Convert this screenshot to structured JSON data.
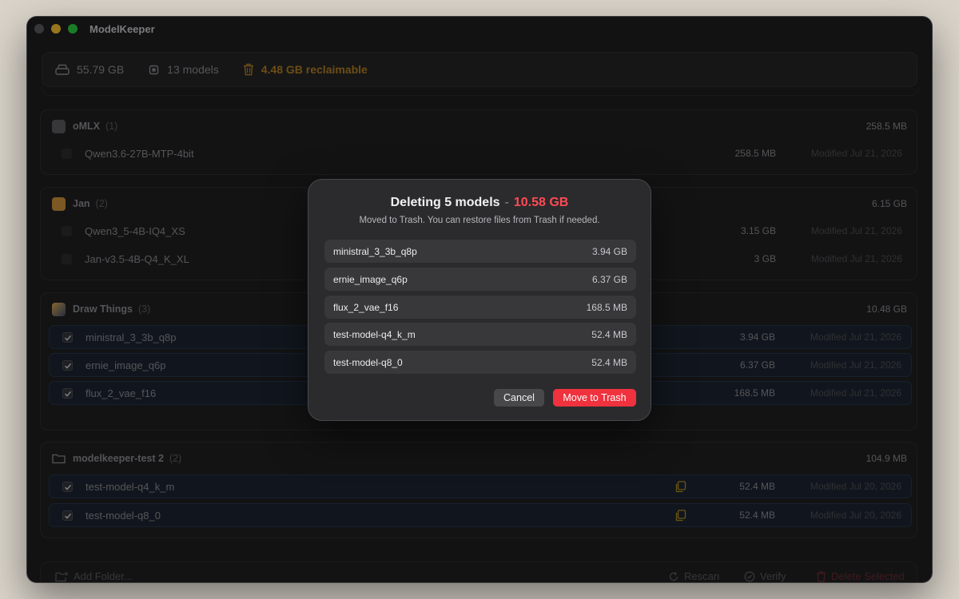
{
  "window": {
    "title": "ModelKeeper"
  },
  "stats": {
    "total_size": "55.79 GB",
    "model_count": "13 models",
    "reclaimable": "4.48 GB reclaimable"
  },
  "groups": [
    {
      "name": "oMLX",
      "count": "(1)",
      "size": "258.5 MB",
      "rows": [
        {
          "name": "Qwen3.6-27B-MTP-4bit",
          "size": "258.5 MB",
          "modified": "Modified Jul 21, 2026",
          "selected": false
        }
      ]
    },
    {
      "name": "Jan",
      "count": "(2)",
      "size": "6.15 GB",
      "rows": [
        {
          "name": "Qwen3_5-4B-IQ4_XS",
          "size": "3.15 GB",
          "modified": "Modified Jul 21, 2026",
          "selected": false
        },
        {
          "name": "Jan-v3.5-4B-Q4_K_XL",
          "size": "3 GB",
          "modified": "Modified Jul 21, 2026",
          "selected": false
        }
      ]
    },
    {
      "name": "Draw Things",
      "count": "(3)",
      "size": "10.48 GB",
      "rows": [
        {
          "name": "ministral_3_3b_q8p",
          "size": "3.94 GB",
          "modified": "Modified Jul 21, 2026",
          "selected": true
        },
        {
          "name": "ernie_image_q6p",
          "size": "6.37 GB",
          "modified": "Modified Jul 21, 2026",
          "selected": true
        },
        {
          "name": "flux_2_vae_f16",
          "size": "168.5 MB",
          "modified": "Modified Jul 21, 2026",
          "selected": true
        }
      ]
    },
    {
      "name": "modelkeeper-test 2",
      "count": "(2)",
      "size": "104.9 MB",
      "rows": [
        {
          "name": "test-model-q4_k_m",
          "size": "52.4 MB",
          "modified": "Modified Jul 20, 2026",
          "selected": true
        },
        {
          "name": "test-model-q8_0",
          "size": "52.4 MB",
          "modified": "Modified Jul 20, 2026",
          "selected": true
        }
      ]
    }
  ],
  "bottombar": {
    "add_folder": "Add Folder...",
    "rescan": "Rescan",
    "verify": "Verify",
    "delete_selected": "Delete Selected"
  },
  "dialog": {
    "title": "Deleting 5 models",
    "separator": "-",
    "total": "10.58 GB",
    "subtitle": "Moved to Trash. You can restore files from Trash if needed.",
    "items": [
      {
        "name": "ministral_3_3b_q8p",
        "size": "3.94 GB"
      },
      {
        "name": "ernie_image_q6p",
        "size": "6.37 GB"
      },
      {
        "name": "flux_2_vae_f16",
        "size": "168.5 MB"
      },
      {
        "name": "test-model-q4_k_m",
        "size": "52.4 MB"
      },
      {
        "name": "test-model-q8_0",
        "size": "52.4 MB"
      }
    ],
    "cancel_label": "Cancel",
    "confirm_label": "Move to Trash"
  },
  "colors": {
    "accent_danger": "#f0323e",
    "reclaim": "#b07d1f",
    "selected_row": "#1c2431"
  }
}
